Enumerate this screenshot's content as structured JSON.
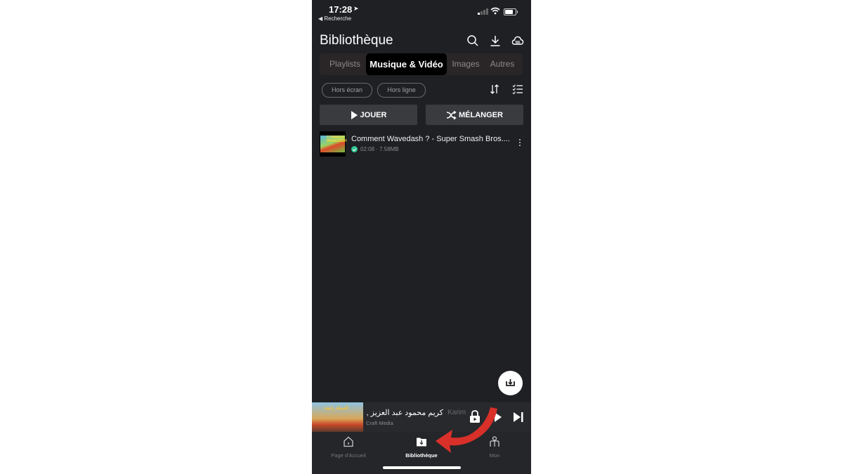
{
  "status_bar": {
    "time": "17:28",
    "location_icon": "location-arrow-icon",
    "back_label": "◀ Recherche",
    "signal_bars": 4,
    "signal_active": 1,
    "battery_level_percent": 70
  },
  "header": {
    "title": "Bibliothèque",
    "icons": [
      "search-icon",
      "download-icon",
      "cloud-sync-icon"
    ]
  },
  "tabs": [
    {
      "label": "Playlists",
      "active": false
    },
    {
      "label": "Musique & Vidéo",
      "active": true
    },
    {
      "label": "Images",
      "active": false
    },
    {
      "label": "Autres",
      "active": false
    }
  ],
  "filters": {
    "chips": [
      "Hors écran",
      "Hors ligne"
    ],
    "sort_icon": "sort-icon",
    "select_icon": "checklist-icon"
  },
  "actions": {
    "play_label": "JOUER",
    "shuffle_label": "MÉLANGER"
  },
  "items": [
    {
      "title": "Comment Wavedash ? - Super Smash Bros....",
      "thumb_text": "COMMENT WAVEDASH",
      "duration": "02:08",
      "size": "7.58MB",
      "meta": "02:08 · 7.58MB",
      "status": "downloaded"
    }
  ],
  "fab": {
    "icon": "download-tray-icon"
  },
  "mini_player": {
    "title": "كريم محمود عبد العزيز ,",
    "title_faded": "Karim",
    "subtitle": "Craft Media",
    "art_text": "العملة رابعة",
    "icons": [
      "lock-icon",
      "play-icon",
      "skip-next-icon"
    ]
  },
  "bottom_nav": [
    {
      "label": "Page d'Accueil",
      "icon": "home-icon",
      "active": false
    },
    {
      "label": "Bibliothèque",
      "icon": "folder-download-icon",
      "active": true
    },
    {
      "label": "Mon",
      "icon": "profile-icon",
      "active": false
    }
  ],
  "annotation": {
    "type": "red-curved-arrow",
    "points_to": "Bibliothèque",
    "color": "#d9302a"
  },
  "colors": {
    "background": "#1f2024",
    "tab_bar": "#2a2527",
    "button": "#3a3b3f",
    "accent_check": "#2ec58f"
  }
}
